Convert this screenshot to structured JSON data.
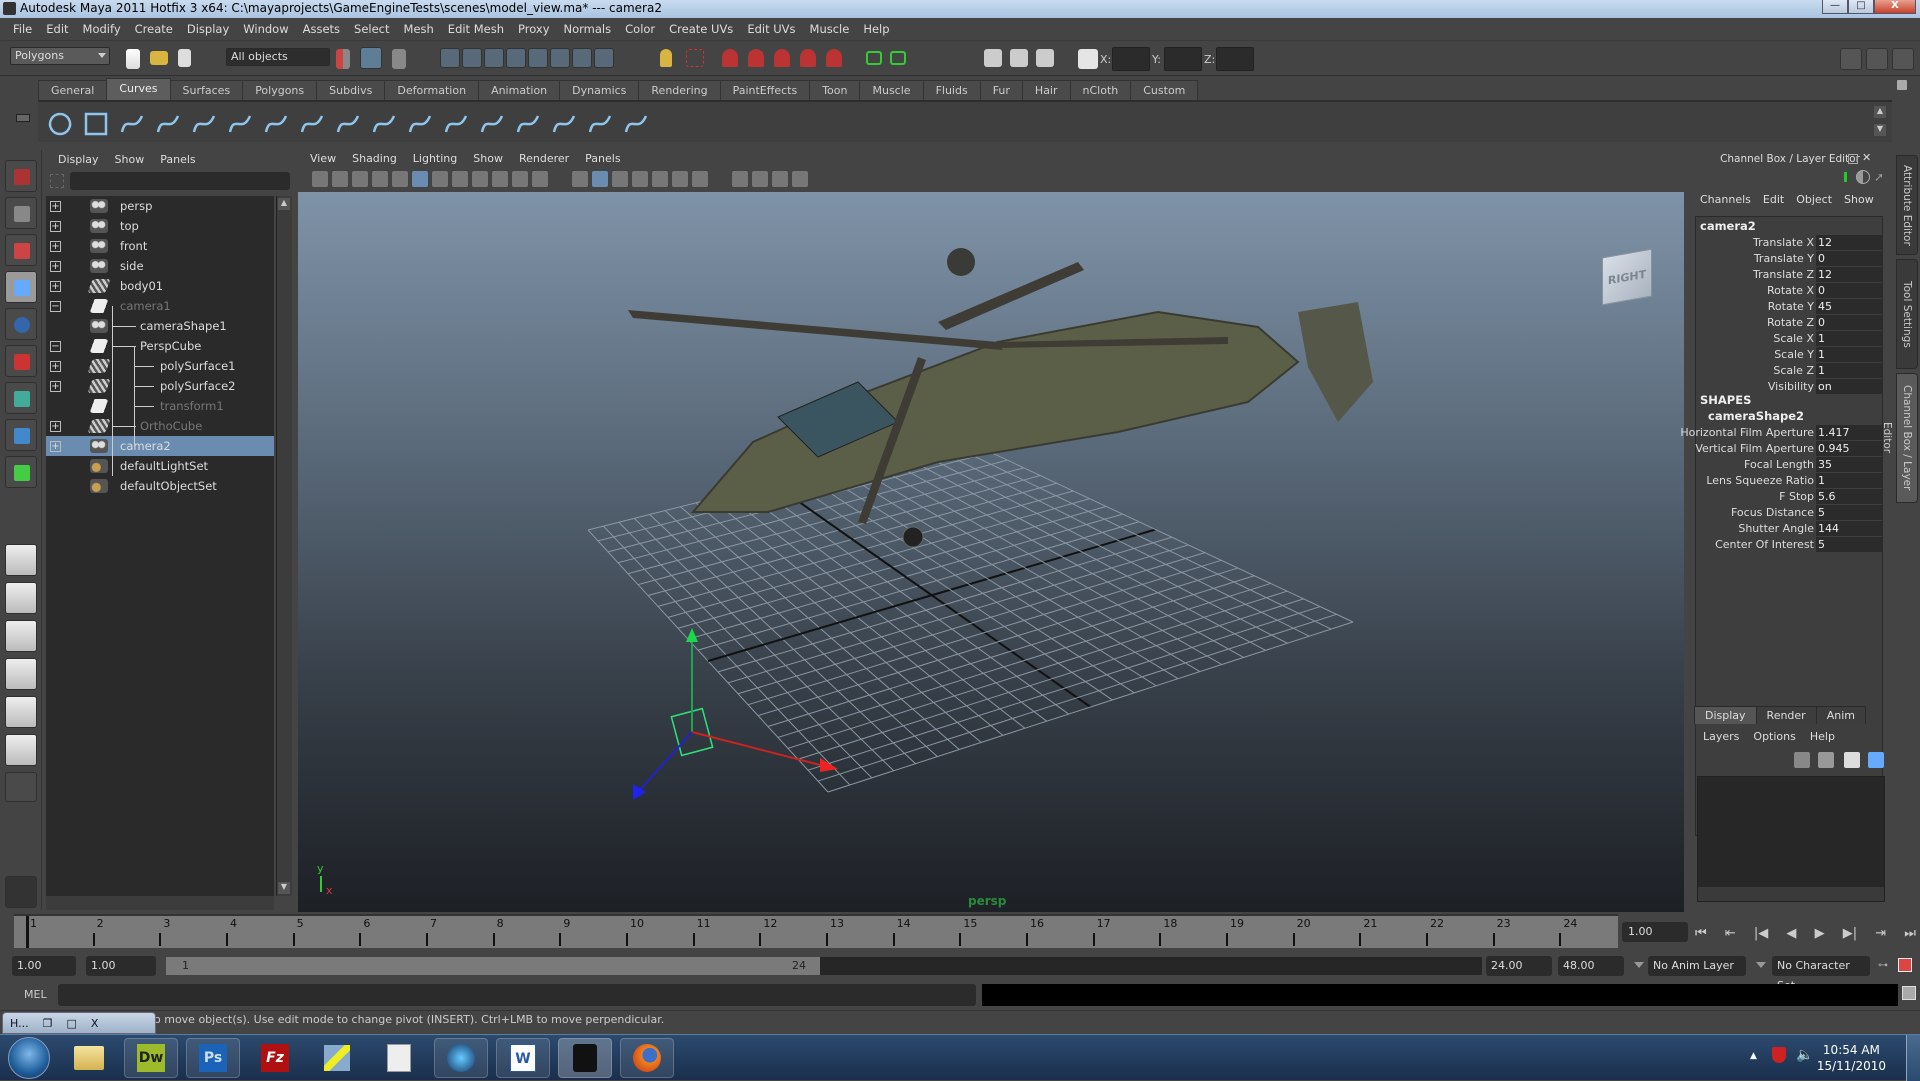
{
  "window": {
    "title": "Autodesk Maya 2011 Hotfix 3 x64: C:\\mayaprojects\\GameEngineTests\\scenes\\model_view.ma*   ---   camera2",
    "controls": {
      "minimize": "—",
      "maximize": "□",
      "close": "X"
    }
  },
  "menubar": [
    "File",
    "Edit",
    "Modify",
    "Create",
    "Display",
    "Window",
    "Assets",
    "Select",
    "Mesh",
    "Edit Mesh",
    "Proxy",
    "Normals",
    "Color",
    "Create UVs",
    "Edit UVs",
    "Muscle",
    "Help"
  ],
  "statusline": {
    "menuset": "Polygons",
    "selection_filter": "All objects",
    "coord_labels": [
      "X:",
      "Y:",
      "Z:"
    ],
    "coord_values": [
      "",
      "",
      ""
    ]
  },
  "shelf": {
    "tabs": [
      "General",
      "Curves",
      "Surfaces",
      "Polygons",
      "Subdivs",
      "Deformation",
      "Animation",
      "Dynamics",
      "Rendering",
      "PaintEffects",
      "Toon",
      "Muscle",
      "Fluids",
      "Fur",
      "Hair",
      "nCloth",
      "Custom"
    ],
    "active_tab": "Curves",
    "icons": [
      "nurbs-circle",
      "nurbs-square",
      "cv-curve",
      "ep-curve",
      "pencil-curve",
      "arc-tool",
      "offset-curve",
      "detach-curve",
      "attach-curve",
      "fillet-curve",
      "rebuild-curve",
      "extend-curve",
      "insert-knot",
      "cut-curve",
      "reverse-curve",
      "curve-editing",
      "bezier-tool"
    ]
  },
  "outliner": {
    "menu": [
      "Display",
      "Show",
      "Panels"
    ],
    "filter_value": "",
    "items": [
      {
        "label": "persp",
        "icon": "camera",
        "expand": "+",
        "depth": 0,
        "dim": false,
        "selected": false
      },
      {
        "label": "top",
        "icon": "camera",
        "expand": "+",
        "depth": 0,
        "dim": false,
        "selected": false
      },
      {
        "label": "front",
        "icon": "camera",
        "expand": "+",
        "depth": 0,
        "dim": false,
        "selected": false
      },
      {
        "label": "side",
        "icon": "camera",
        "expand": "+",
        "depth": 0,
        "dim": false,
        "selected": false
      },
      {
        "label": "body01",
        "icon": "mesh",
        "expand": "+",
        "depth": 0,
        "dim": false,
        "selected": false
      },
      {
        "label": "camera1",
        "icon": "transform",
        "expand": "−",
        "depth": 0,
        "dim": true,
        "selected": false
      },
      {
        "label": "cameraShape1",
        "icon": "camera",
        "expand": "",
        "depth": 1,
        "dim": false,
        "selected": false
      },
      {
        "label": "PerspCube",
        "icon": "transform",
        "expand": "−",
        "depth": 1,
        "dim": false,
        "selected": false
      },
      {
        "label": "polySurface1",
        "icon": "mesh",
        "expand": "+",
        "depth": 2,
        "dim": false,
        "selected": false
      },
      {
        "label": "polySurface2",
        "icon": "mesh",
        "expand": "+",
        "depth": 2,
        "dim": false,
        "selected": false
      },
      {
        "label": "transform1",
        "icon": "transform",
        "expand": "",
        "depth": 2,
        "dim": true,
        "selected": false
      },
      {
        "label": "OrthoCube",
        "icon": "mesh",
        "expand": "+",
        "depth": 1,
        "dim": true,
        "selected": false
      },
      {
        "label": "camera2",
        "icon": "camera",
        "expand": "+",
        "depth": 0,
        "dim": false,
        "selected": true
      },
      {
        "label": "defaultLightSet",
        "icon": "set",
        "expand": "",
        "depth": 0,
        "dim": false,
        "selected": false
      },
      {
        "label": "defaultObjectSet",
        "icon": "set",
        "expand": "",
        "depth": 0,
        "dim": false,
        "selected": false
      }
    ]
  },
  "viewport": {
    "menu": [
      "View",
      "Shading",
      "Lighting",
      "Show",
      "Renderer",
      "Panels"
    ],
    "camera_label": "persp",
    "viewcube_face": "RIGHT",
    "axis_labels": {
      "y": "y",
      "x": "x"
    }
  },
  "channel_box": {
    "header": "Channel Box / Layer Editor",
    "menu": [
      "Channels",
      "Edit",
      "Object",
      "Show"
    ],
    "object": "camera2",
    "channels": [
      {
        "name": "Translate X",
        "value": "12"
      },
      {
        "name": "Translate Y",
        "value": "0"
      },
      {
        "name": "Translate Z",
        "value": "12"
      },
      {
        "name": "Rotate X",
        "value": "0"
      },
      {
        "name": "Rotate Y",
        "value": "45"
      },
      {
        "name": "Rotate Z",
        "value": "0"
      },
      {
        "name": "Scale X",
        "value": "1"
      },
      {
        "name": "Scale Y",
        "value": "1"
      },
      {
        "name": "Scale Z",
        "value": "1"
      },
      {
        "name": "Visibility",
        "value": "on"
      }
    ],
    "shapes_label": "SHAPES",
    "shape_name": "cameraShape2",
    "shape_channels": [
      {
        "name": "Horizontal Film Aperture",
        "value": "1.417"
      },
      {
        "name": "Vertical Film Aperture",
        "value": "0.945"
      },
      {
        "name": "Focal Length",
        "value": "35"
      },
      {
        "name": "Lens Squeeze Ratio",
        "value": "1"
      },
      {
        "name": "F Stop",
        "value": "5.6"
      },
      {
        "name": "Focus Distance",
        "value": "5"
      },
      {
        "name": "Shutter Angle",
        "value": "144"
      },
      {
        "name": "Center Of Interest",
        "value": "5"
      }
    ]
  },
  "layer_editor": {
    "tabs": [
      "Display",
      "Render",
      "Anim"
    ],
    "active_tab": "Display",
    "menu": [
      "Layers",
      "Options",
      "Help"
    ]
  },
  "side_tabs": [
    "Attribute Editor",
    "Tool Settings",
    "Channel Box / Layer Editor"
  ],
  "time_slider": {
    "ticks": [
      "1",
      "2",
      "3",
      "4",
      "5",
      "6",
      "7",
      "8",
      "9",
      "10",
      "11",
      "12",
      "13",
      "14",
      "15",
      "16",
      "17",
      "18",
      "19",
      "20",
      "21",
      "22",
      "23",
      "24"
    ],
    "current_frame": "1.00",
    "playback_buttons": [
      "⏮",
      "⇤",
      "|◀",
      "◀",
      "▶",
      "▶|",
      "⇥",
      "⏭"
    ]
  },
  "range_slider": {
    "anim_start": "1.00",
    "playback_start": "1.00",
    "range_start_label": "1",
    "range_end_label": "24",
    "playback_end": "24.00",
    "anim_end": "48.00",
    "anim_layer": "No Anim Layer",
    "character_set": "No Character Set"
  },
  "command_line": {
    "label": "MEL",
    "input": "",
    "output": ""
  },
  "help_line": "o move object(s). Use edit mode to change pivot (INSERT).  Ctrl+LMB to move perpendicular.",
  "minimized_window": {
    "label": "H...",
    "buttons": [
      "❐",
      "□",
      "X"
    ]
  },
  "taskbar": {
    "apps": [
      "Windows Explorer",
      "Dreamweaver",
      "Photoshop",
      "FileZilla",
      "Network",
      "Notepad",
      "iTunes",
      "Word",
      "Maya",
      "Firefox"
    ],
    "app_labels": {
      "dw": "Dw",
      "ps": "Ps",
      "fz": "Fz",
      "word": "W"
    },
    "clock_time": "10:54 AM",
    "clock_date": "15/11/2010"
  }
}
